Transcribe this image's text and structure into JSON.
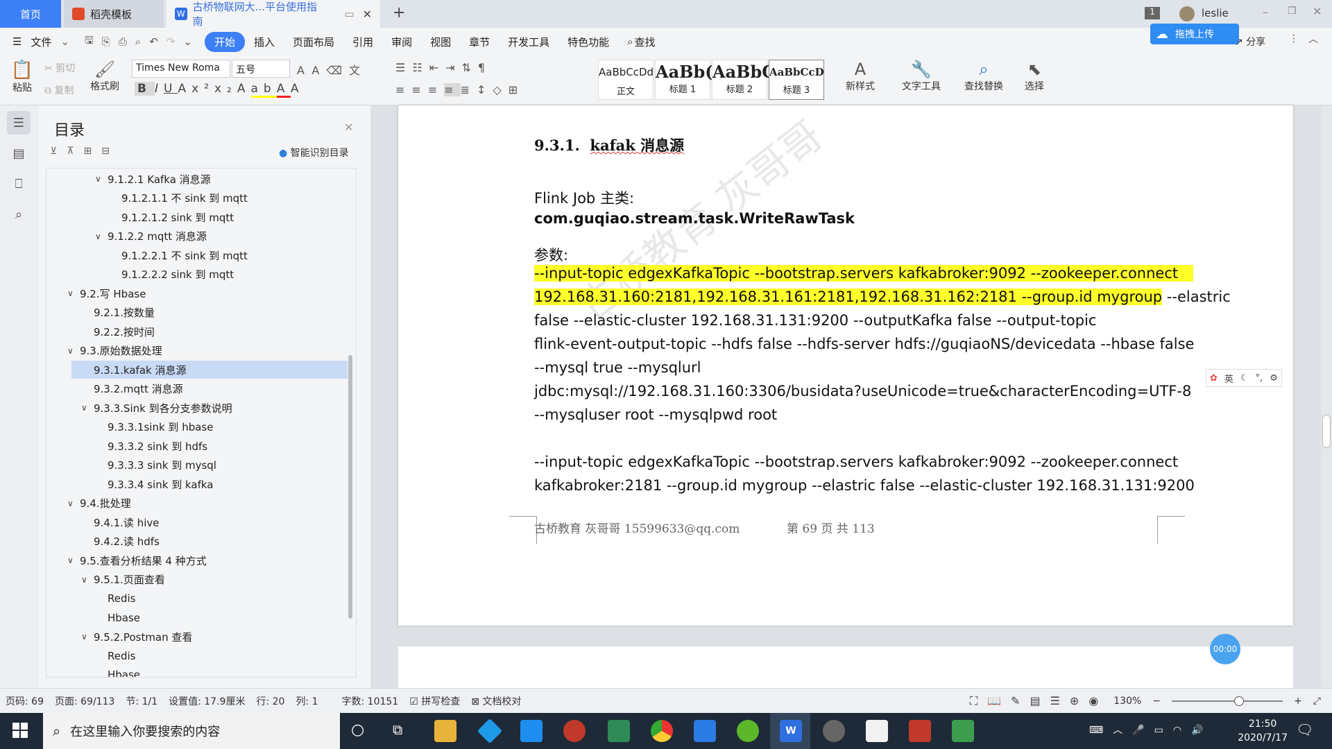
{
  "tabs": {
    "home": "首页",
    "template": "稻壳模板",
    "document": "古桥物联网大...平台使用指南"
  },
  "window": {
    "page_badge": "1",
    "user": "leslie"
  },
  "menu": {
    "file": "文件",
    "items": [
      "开始",
      "插入",
      "页面布局",
      "引用",
      "审阅",
      "视图",
      "章节",
      "开发工具",
      "特色功能"
    ],
    "search": "查找",
    "share": "分享",
    "upload": "拖拽上传"
  },
  "ribbon": {
    "paste": "粘贴",
    "cut": "剪切",
    "copy": "复制",
    "format_painter": "格式刷",
    "font": "Times New Roma",
    "size": "五号",
    "styles": [
      {
        "preview": "AaBbCcDd",
        "label": "正文"
      },
      {
        "preview": "AaBb(",
        "label": "标题 1"
      },
      {
        "preview": "AaBbC",
        "label": "标题 2"
      },
      {
        "preview": "AaBbCcD",
        "label": "标题 3"
      }
    ],
    "new_style": "新样式",
    "text_tools": "文字工具",
    "find_replace": "查找替换",
    "select": "选择"
  },
  "outline": {
    "title": "目录",
    "smart": "智能识别目录",
    "items": [
      {
        "text": "9.1.2.1 Kafka 消息源",
        "level": 2,
        "chev": "v"
      },
      {
        "text": "9.1.2.1.1 不 sink 到 mqtt",
        "level": 3,
        "chev": ""
      },
      {
        "text": "9.1.2.1.2 sink 到 mqtt",
        "level": 3,
        "chev": ""
      },
      {
        "text": "9.1.2.2 mqtt 消息源",
        "level": 2,
        "chev": "v"
      },
      {
        "text": "9.1.2.2.1 不 sink 到 mqtt",
        "level": 3,
        "chev": ""
      },
      {
        "text": "9.1.2.2.2 sink 到 mqtt",
        "level": 3,
        "chev": ""
      },
      {
        "text": "9.2.写 Hbase",
        "level": 0,
        "chev": "v"
      },
      {
        "text": "9.2.1.按数量",
        "level": 1,
        "chev": ""
      },
      {
        "text": "9.2.2.按时间",
        "level": 1,
        "chev": ""
      },
      {
        "text": "9.3.原始数据处理",
        "level": 0,
        "chev": "v"
      },
      {
        "text": "9.3.1.kafak 消息源",
        "level": 1,
        "chev": "",
        "selected": true
      },
      {
        "text": "9.3.2.mqtt 消息源",
        "level": 1,
        "chev": ""
      },
      {
        "text": "9.3.3.Sink 到各分支参数说明",
        "level": 1,
        "chev": "v"
      },
      {
        "text": "9.3.3.1sink 到 hbase",
        "level": 2,
        "chev": ""
      },
      {
        "text": "9.3.3.2 sink 到 hdfs",
        "level": 2,
        "chev": ""
      },
      {
        "text": "9.3.3.3 sink 到 mysql",
        "level": 2,
        "chev": ""
      },
      {
        "text": "9.3.3.4 sink 到 kafka",
        "level": 2,
        "chev": ""
      },
      {
        "text": "9.4.批处理",
        "level": 0,
        "chev": "v"
      },
      {
        "text": "9.4.1.读 hive",
        "level": 1,
        "chev": ""
      },
      {
        "text": "9.4.2.读 hdfs",
        "level": 1,
        "chev": ""
      },
      {
        "text": "9.5.查看分析结果 4 种方式",
        "level": 0,
        "chev": "v"
      },
      {
        "text": "9.5.1.页面查看",
        "level": 1,
        "chev": "v"
      },
      {
        "text": "Redis",
        "level": 2,
        "chev": ""
      },
      {
        "text": "Hbase",
        "level": 2,
        "chev": ""
      },
      {
        "text": "9.5.2.Postman 查看",
        "level": 1,
        "chev": "v"
      },
      {
        "text": "Redis",
        "level": 2,
        "chev": ""
      },
      {
        "text": "Hbase",
        "level": 2,
        "chev": ""
      }
    ]
  },
  "doc": {
    "heading_num": "9.3.1.",
    "heading_text": "kafak 消息源",
    "job_label": "Flink Job  主类:",
    "job_class": "com.guqiao.stream.task.WriteRawTask",
    "params_label": "参数:",
    "p1a": "--input-topic edgexKafkaTopic --bootstrap.servers kafkabroker:9092 --zookeeper.connect",
    "p1b": "192.168.31.160:2181,192.168.31.161:2181,192.168.31.162:2181 --group.id mygroup",
    "p1b_rest": " --elastric",
    "p1c": "false --elastic-cluster 192.168.31.131:9200 --outputKafka false --output-topic",
    "p1d": "flink-event-output-topic --hdfs false --hdfs-server hdfs://guqiaoNS/devicedata --hbase false",
    "p1e": "--mysql true --mysqlurl",
    "p1f": "jdbc:mysql://192.168.31.160:3306/busidata?useUnicode=true&characterEncoding=UTF-8",
    "p1g": "--mysqluser root --mysqlpwd root",
    "p2a": "--input-topic edgexKafkaTopic --bootstrap.servers kafkabroker:9092 --zookeeper.connect",
    "p2b": "kafkabroker:2181 --group.id mygroup --elastric false --elastic-cluster 192.168.31.131:9200",
    "footer_left": "古桥教育 灰哥哥 15599633@qq.com",
    "footer_right": "第 69 页 共 113",
    "watermark": "古桥教育 灰哥哥",
    "float_tools": "英",
    "timer": "00:00"
  },
  "status": {
    "page": "页码: 69",
    "pages": "页面: 69/113",
    "section": "节: 1/1",
    "setting": "设置值: 17.9厘米",
    "row": "行: 20",
    "col": "列: 1",
    "words": "字数: 10151",
    "spell": "拼写检查",
    "proof": "文档校对",
    "zoom": "130%"
  },
  "taskbar": {
    "search": "在这里输入你要搜索的内容",
    "time": "21:50",
    "date": "2020/7/17"
  },
  "colors": {
    "accent": "#3d7ff5",
    "highlight": "#ffff2a",
    "taskbar": "#1f2a38"
  }
}
